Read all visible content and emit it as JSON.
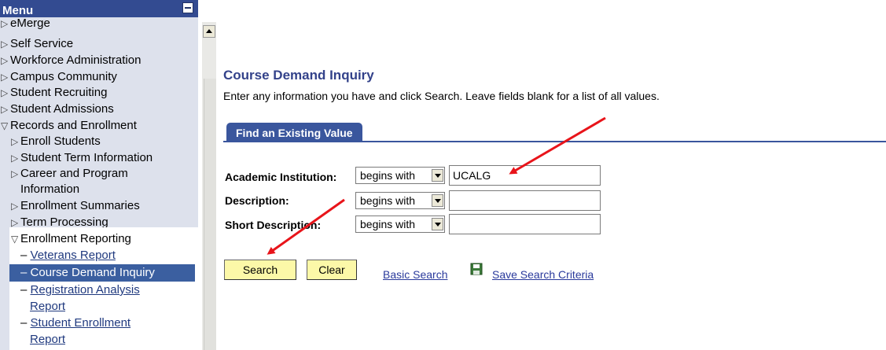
{
  "menu": {
    "title": "Menu",
    "items": [
      {
        "label": "eMerge"
      },
      {
        "label": "Self Service"
      },
      {
        "label": "Workforce Administration"
      },
      {
        "label": "Campus Community"
      },
      {
        "label": "Student Recruiting"
      },
      {
        "label": "Student Admissions"
      },
      {
        "label": "Records and Enrollment"
      },
      {
        "label": "Enroll Students"
      },
      {
        "label": "Student Term Information"
      },
      {
        "label": "Career and Program"
      },
      {
        "label": "Information"
      },
      {
        "label": "Enrollment Summaries"
      },
      {
        "label": "Term Processing"
      },
      {
        "label": "Enrollment Reporting"
      },
      {
        "label": "Veterans Report"
      },
      {
        "label": "Course Demand Inquiry"
      },
      {
        "label": "Registration Analysis"
      },
      {
        "label": "Report"
      },
      {
        "label": "Student Enrollment"
      },
      {
        "label": "Report"
      }
    ],
    "dash": "–"
  },
  "page": {
    "title": "Course Demand Inquiry",
    "instructions": "Enter any information you have and click Search. Leave fields blank for a list of all values.",
    "tab": "Find an Existing Value"
  },
  "fields": [
    {
      "label": "Academic Institution:",
      "operator": "begins with",
      "value": "UCALG"
    },
    {
      "label": "Description:",
      "operator": "begins with",
      "value": ""
    },
    {
      "label": "Short Description:",
      "operator": "begins with",
      "value": ""
    }
  ],
  "actions": {
    "search": "Search",
    "clear": "Clear",
    "basic_search": "Basic Search",
    "save_criteria": "Save Search Criteria"
  },
  "colors": {
    "menu_header": "#334b91",
    "menu_bg": "#dde1ec",
    "selected_item": "#3b5fa0",
    "button_bg": "#fcf8a8",
    "annotation_arrow": "#e8141a"
  }
}
